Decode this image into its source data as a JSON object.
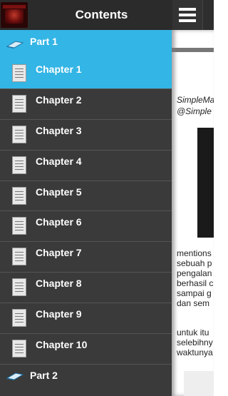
{
  "app": {
    "title": "Contents",
    "icon": "app-logo-icon",
    "menu_icon": "hamburger-menu-icon"
  },
  "colors": {
    "accent": "#33b5e5",
    "drawer_bg": "#3a3a3a",
    "topbar_bg": "#2b2b2b"
  },
  "drawer": {
    "parts": [
      {
        "label": "Part 1",
        "icon": "book-icon",
        "selected": true
      },
      {
        "label": "Part 2",
        "icon": "book-icon",
        "selected": false
      }
    ],
    "chapters": [
      {
        "label": "Chapter 1",
        "icon": "document-icon",
        "active": true
      },
      {
        "label": "Chapter 2",
        "icon": "document-icon",
        "active": false
      },
      {
        "label": "Chapter 3",
        "icon": "document-icon",
        "active": false
      },
      {
        "label": "Chapter 4",
        "icon": "document-icon",
        "active": false
      },
      {
        "label": "Chapter 5",
        "icon": "document-icon",
        "active": false
      },
      {
        "label": "Chapter 6",
        "icon": "document-icon",
        "active": false
      },
      {
        "label": "Chapter 7",
        "icon": "document-icon",
        "active": false
      },
      {
        "label": "Chapter 8",
        "icon": "document-icon",
        "active": false
      },
      {
        "label": "Chapter 9",
        "icon": "document-icon",
        "active": false
      },
      {
        "label": "Chapter 10",
        "icon": "document-icon",
        "active": false
      }
    ]
  },
  "article": {
    "byline": [
      "SimpleMa",
      "@Simple"
    ],
    "paragraph1": [
      "mentions",
      "sebuah p",
      "pengalan",
      "berhasil c",
      "sampai g",
      "dan sem"
    ],
    "paragraph2": [
      "untuk itu",
      "selebihny",
      "waktunya"
    ]
  }
}
